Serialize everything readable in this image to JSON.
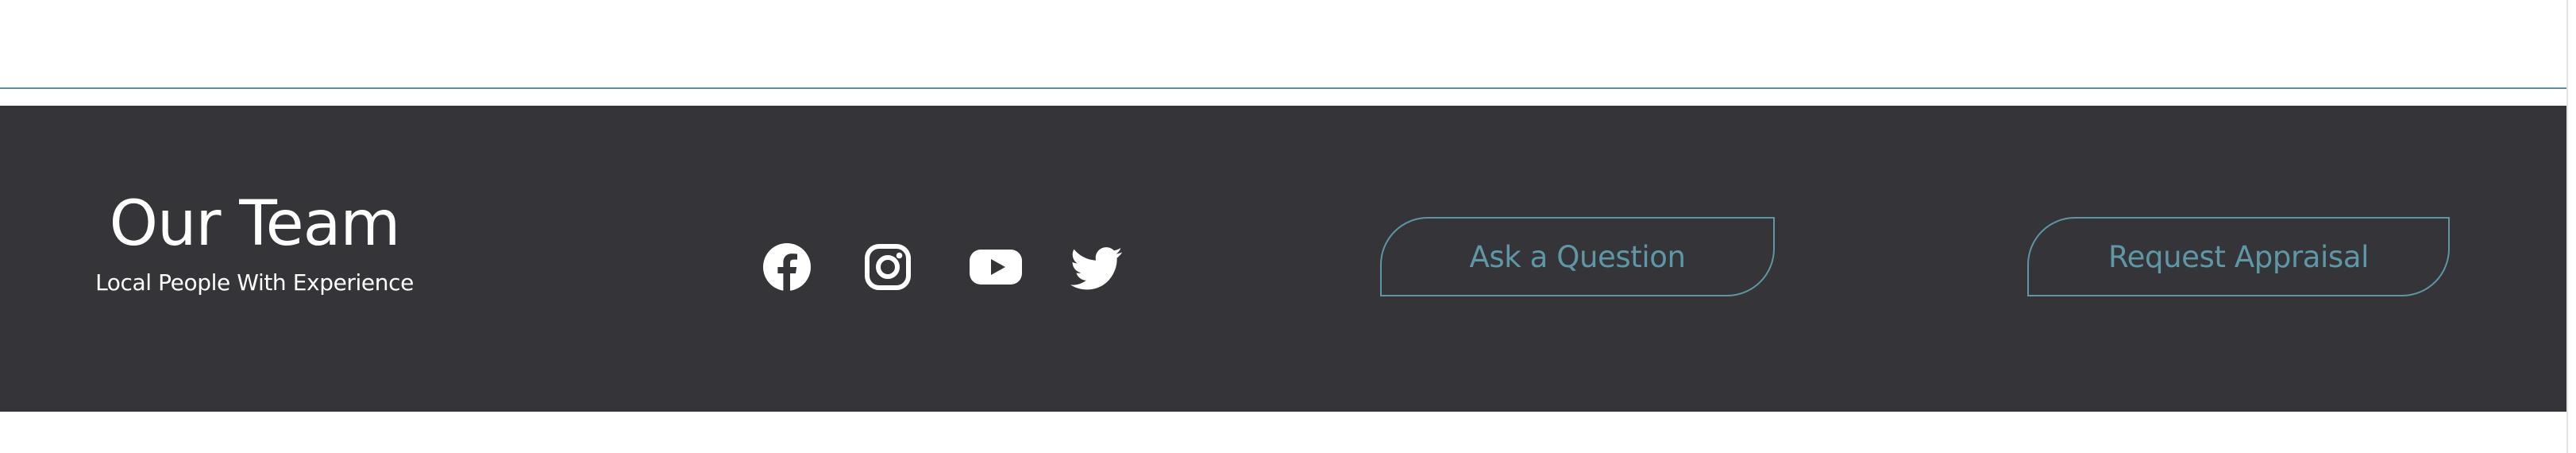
{
  "footer": {
    "team_title": "Our Team",
    "team_subtitle": "Local People With Experience",
    "social_links": [
      {
        "label": "Facebook",
        "icon": "facebook-icon"
      },
      {
        "label": "Instagram",
        "icon": "instagram-icon"
      },
      {
        "label": "YouTube",
        "icon": "youtube-icon"
      },
      {
        "label": "Twitter",
        "icon": "twitter-icon"
      }
    ],
    "ask_question_label": "Ask a Question",
    "request_appraisal_label": "Request Appraisal"
  },
  "colors": {
    "background": "#ffffff",
    "footer_background": "#353439",
    "accent": "#5d97a4",
    "text_light": "#ffffff"
  }
}
